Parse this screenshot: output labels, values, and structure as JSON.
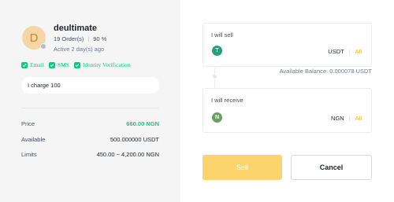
{
  "advertiser": {
    "avatar_letter": "D",
    "name": "deultimate",
    "orders": "19 Order(s)",
    "completion": "90 %",
    "active": "Active 2 day(s) ago",
    "verifications": [
      "Email",
      "SMS",
      "Identity Verification"
    ],
    "remark": "I charge 100"
  },
  "details": [
    {
      "label": "Price",
      "value": "660.00 NGN"
    },
    {
      "label": "Available",
      "value": "500.000000 USDT"
    },
    {
      "label": "Limits",
      "value": "450.00 ~ 4,200.00 NGN"
    }
  ],
  "sell_box": {
    "title": "I will sell",
    "coin_icon": "T",
    "currency": "USDT",
    "all_label": "All"
  },
  "available_balance": "Available Balance: 0.000078 USDT",
  "receive_box": {
    "title": "I will receive",
    "coin_icon": "N",
    "currency": "NGN",
    "all_label": "All"
  },
  "buttons": {
    "sell": "Sell",
    "cancel": "Cancel"
  },
  "colors": {
    "green": "#0ecb81",
    "brand_yellow": "#f0b90b",
    "sell_button": "#fbd46d",
    "usdt_icon": "#26a17b",
    "ngn_icon": "#6a9f62"
  }
}
